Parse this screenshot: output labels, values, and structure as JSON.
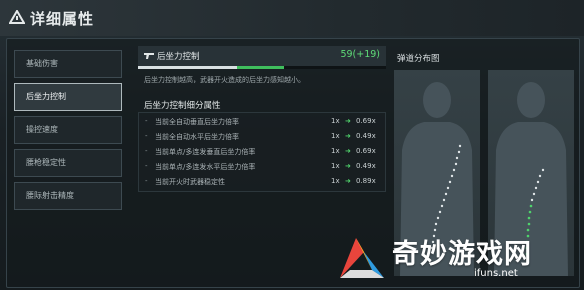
{
  "header": {
    "title": "详细属性"
  },
  "sidebar": {
    "items": [
      {
        "label": "基础伤害",
        "active": false
      },
      {
        "label": "后坐力控制",
        "active": true
      },
      {
        "label": "操控速度",
        "active": false
      },
      {
        "label": "腰枪稳定性",
        "active": false
      },
      {
        "label": "腰际射击精度",
        "active": false
      }
    ]
  },
  "detail": {
    "name": "后坐力控制",
    "value": "59(+19)",
    "progress_base": 0.4,
    "progress_total": 0.59,
    "description": "后坐力控制越高，武器开火造成的后坐力感知越小。",
    "section_title": "后坐力控制细分属性",
    "stats": [
      {
        "label": "当前全自动垂直后坐力倍率",
        "from": "1x",
        "to": "0.69x"
      },
      {
        "label": "当前全自动水平后坐力倍率",
        "from": "1x",
        "to": "0.49x"
      },
      {
        "label": "当前单点/多连发垂直后坐力倍率",
        "from": "1x",
        "to": "0.69x"
      },
      {
        "label": "当前单点/多连发水平后坐力倍率",
        "from": "1x",
        "to": "0.49x"
      },
      {
        "label": "当前开火时武器稳定性",
        "from": "1x",
        "to": "0.89x"
      }
    ]
  },
  "ballistics": {
    "title": "弹道分布图"
  },
  "colors": {
    "accent": "#5fdc78",
    "active_border": "#aeb9bd"
  },
  "watermark": {
    "title": "奇妙游戏网",
    "url": "ifuns.net"
  }
}
